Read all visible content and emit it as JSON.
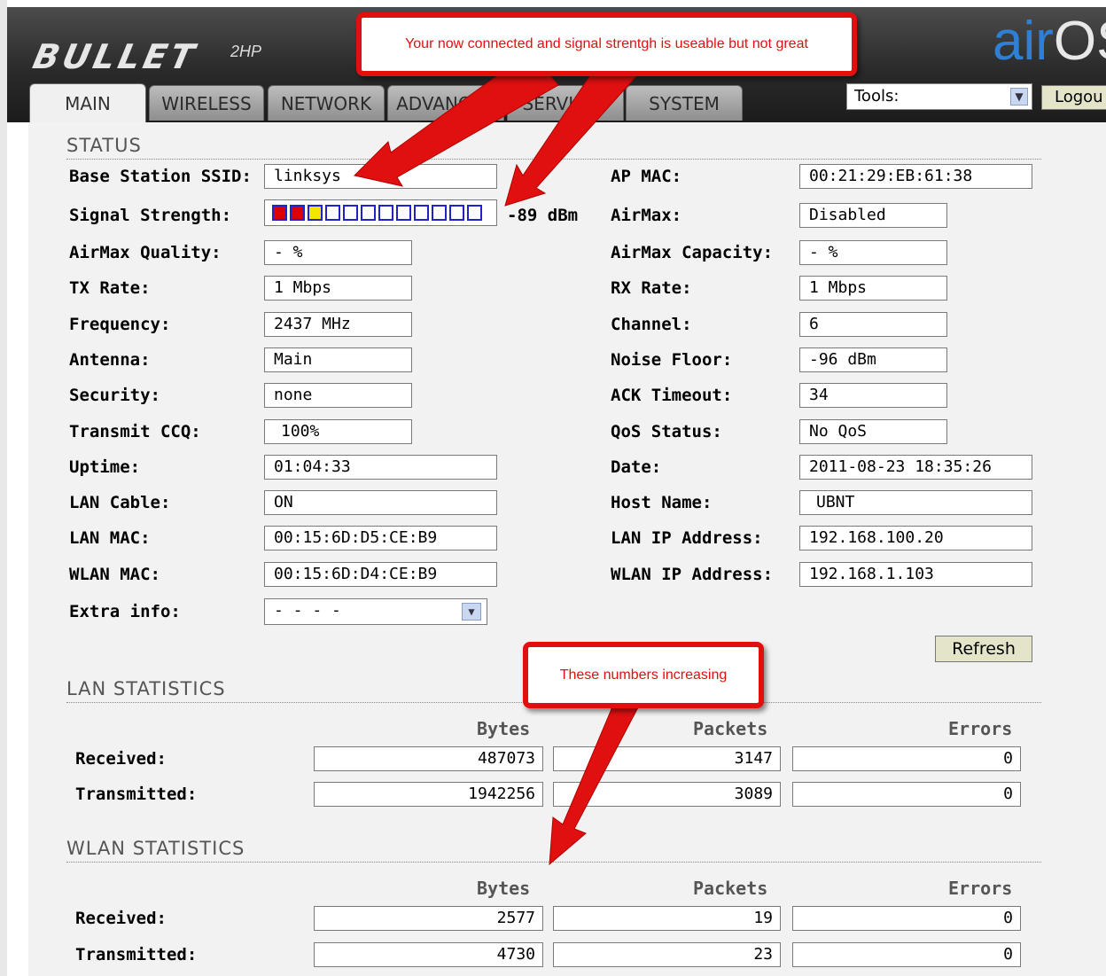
{
  "header": {
    "logo": "BULLET",
    "model": "2HP",
    "brand_air": "air",
    "brand_os": "OS",
    "tabs": [
      "MAIN",
      "WIRELESS",
      "NETWORK",
      "ADVANCED",
      "SERVICES",
      "SYSTEM"
    ],
    "active_tab": "MAIN",
    "tools_label": "Tools:",
    "logout_label": "Logou"
  },
  "status": {
    "title": "STATUS",
    "left": [
      {
        "label": "Base Station SSID:",
        "value": "linksys"
      },
      {
        "label": "Signal Strength:",
        "value": "-89 dBm"
      },
      {
        "label": "AirMax Quality:",
        "value": "- %"
      },
      {
        "label": "TX Rate:",
        "value": "1 Mbps"
      },
      {
        "label": "Frequency:",
        "value": "2437 MHz"
      },
      {
        "label": "Antenna:",
        "value": "Main"
      },
      {
        "label": "Security:",
        "value": "none"
      },
      {
        "label": "Transmit CCQ:",
        "value": "100%"
      },
      {
        "label": "Uptime:",
        "value": "01:04:33"
      },
      {
        "label": "LAN Cable:",
        "value": "ON"
      },
      {
        "label": "LAN MAC:",
        "value": "00:15:6D:D5:CE:B9"
      },
      {
        "label": "WLAN MAC:",
        "value": "00:15:6D:D4:CE:B9"
      },
      {
        "label": "Extra info:",
        "value": "- - - -"
      }
    ],
    "right": [
      {
        "label": "AP MAC:",
        "value": "00:21:29:EB:61:38"
      },
      {
        "label": "AirMax:",
        "value": "Disabled"
      },
      {
        "label": "AirMax Capacity:",
        "value": "- %"
      },
      {
        "label": "RX Rate:",
        "value": "1 Mbps"
      },
      {
        "label": "Channel:",
        "value": "6"
      },
      {
        "label": "Noise Floor:",
        "value": "-96 dBm"
      },
      {
        "label": "ACK Timeout:",
        "value": "34"
      },
      {
        "label": "QoS Status:",
        "value": "No QoS"
      },
      {
        "label": "Date:",
        "value": "2011-08-23 18:35:26"
      },
      {
        "label": "Host Name:",
        "value": "UBNT"
      },
      {
        "label": "LAN IP Address:",
        "value": "192.168.100.20"
      },
      {
        "label": "WLAN IP Address:",
        "value": "192.168.1.103"
      }
    ],
    "signal_bars": {
      "total": 12,
      "red": 2,
      "yellow": 1
    },
    "refresh_label": "Refresh"
  },
  "lan_stats": {
    "title": "LAN STATISTICS",
    "columns": [
      "Bytes",
      "Packets",
      "Errors"
    ],
    "rows": [
      {
        "label": "Received:",
        "bytes": "487073",
        "packets": "3147",
        "errors": "0"
      },
      {
        "label": "Transmitted:",
        "bytes": "1942256",
        "packets": "3089",
        "errors": "0"
      }
    ]
  },
  "wlan_stats": {
    "title": "WLAN STATISTICS",
    "columns": [
      "Bytes",
      "Packets",
      "Errors"
    ],
    "rows": [
      {
        "label": "Received:",
        "bytes": "2577",
        "packets": "19",
        "errors": "0"
      },
      {
        "label": "Transmitted:",
        "bytes": "4730",
        "packets": "23",
        "errors": "0"
      }
    ]
  },
  "annotations": {
    "callout_signal": "Your now connected and signal strentgh is useable but not great",
    "callout_numbers": "These numbers increasing"
  },
  "colors": {
    "callout_red": "#e01010",
    "bar_red": "#dd0000",
    "bar_yellow": "#f2e600",
    "bar_border": "#2222cc"
  }
}
